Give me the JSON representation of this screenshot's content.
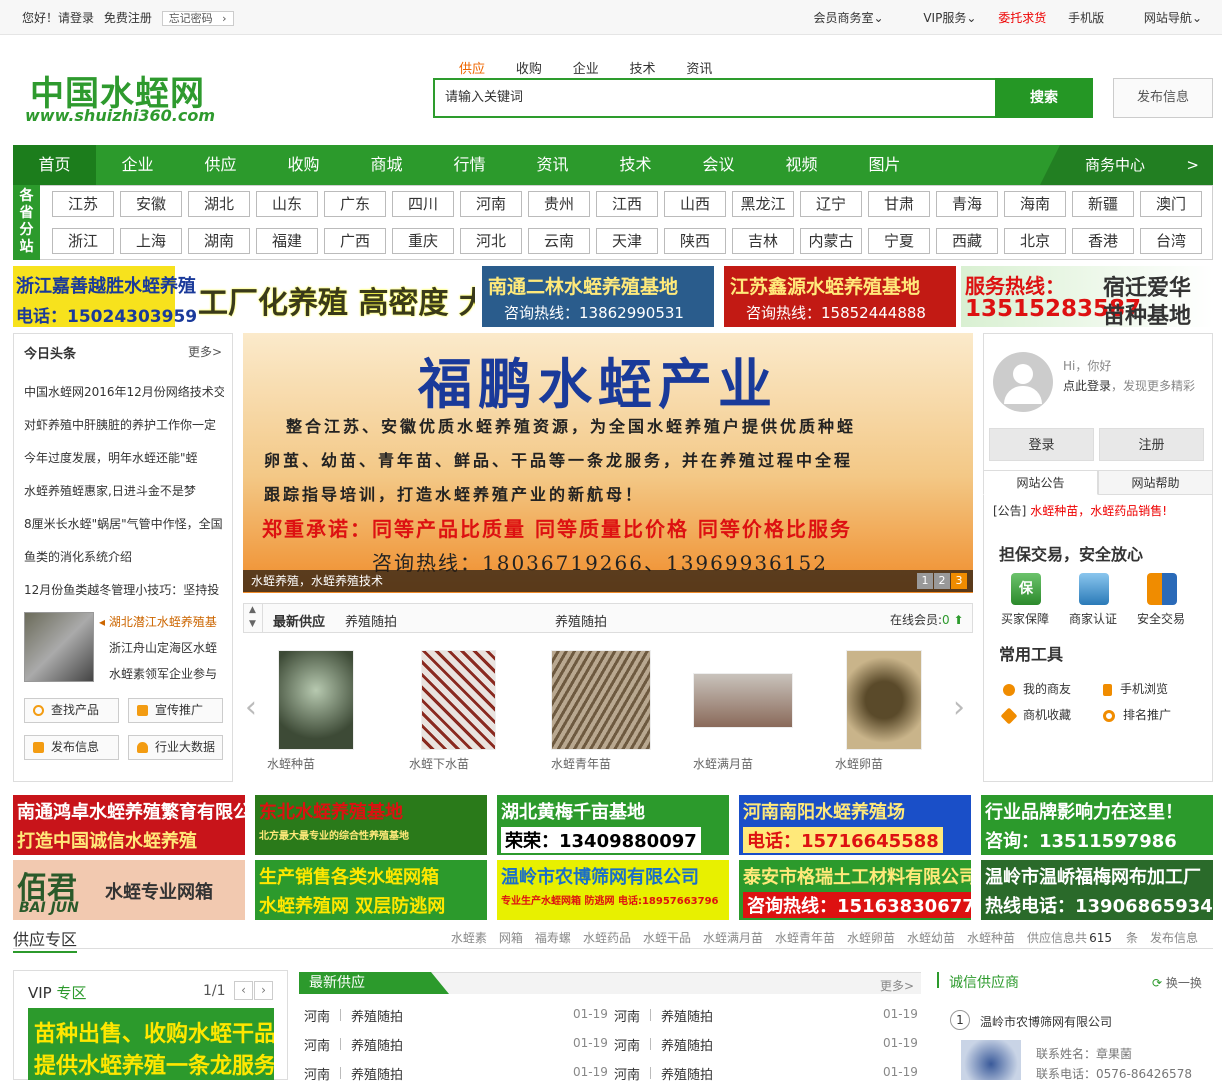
{
  "topbar": {
    "greeting": "您好！请登录",
    "register": "免费注册",
    "forgot": "忘记密码",
    "links": [
      "会员商务室",
      "VIP服务",
      "委托求货",
      "手机版",
      "网站导航"
    ]
  },
  "header": {
    "logo_cn": "中国水蛭网",
    "logo_url": "www.shuizhi360.com",
    "search_tabs": [
      "供应",
      "收购",
      "企业",
      "技术",
      "资讯"
    ],
    "search_placeholder": "请输入关键词",
    "search_button": "搜索",
    "publish_button": "发布信息"
  },
  "nav": {
    "items": [
      "首页",
      "企业",
      "供应",
      "收购",
      "商城",
      "行情",
      "资讯",
      "技术",
      "会议",
      "视频",
      "图片"
    ],
    "business_center": "商务中心",
    "arrow": ">"
  },
  "stations": {
    "label": "各省分站",
    "row1": [
      "江苏",
      "安徽",
      "湖北",
      "山东",
      "广东",
      "四川",
      "河南",
      "贵州",
      "江西",
      "山西",
      "黑龙江",
      "辽宁",
      "甘肃",
      "青海",
      "海南",
      "新疆",
      "澳门"
    ],
    "row2": [
      "浙江",
      "上海",
      "湖南",
      "福建",
      "广西",
      "重庆",
      "河北",
      "云南",
      "天津",
      "陕西",
      "吉林",
      "内蒙古",
      "宁夏",
      "西藏",
      "北京",
      "香港",
      "台湾"
    ]
  },
  "ads_top": {
    "a1_line1": "浙江嘉善越胜水蛭养殖",
    "a1_line2": "电话：15024303959",
    "a1_big": "工厂化养殖 高密度 大克重",
    "a2_line1": "南通二林水蛭养殖基地",
    "a2_line2": "咨询热线：13862990531",
    "a3_line1": "江苏鑫源水蛭养殖基地",
    "a3_line2": "咨询热线：15852444888",
    "a4_line1": "服务热线：",
    "a4_line2": "13515283587",
    "a4_right1": "宿迁爱华",
    "a4_right2": "苗种基地"
  },
  "left": {
    "title": "今日头条",
    "more": "更多>",
    "news": [
      "中国水蛭网2016年12月份网络技术交",
      "对虾养殖中肝胰脏的养护工作你一定",
      "今年过度发展，明年水蛭还能\"蛭",
      "水蛭养殖蛭惠家,日进斗金不是梦",
      "8厘米长水蛭\"蜗居\"气管中作怪，全国",
      "鱼类的消化系统介绍",
      "12月份鱼类越冬管理小技巧：坚持投"
    ],
    "featured": "湖北潜江水蛭养殖基",
    "sub_news": [
      "浙江舟山定海区水蛭",
      "水蛭素领军企业参与"
    ],
    "buttons": [
      "查找产品",
      "宣传推广",
      "发布信息",
      "行业大数据"
    ]
  },
  "slide": {
    "title": "福鹏水蛭产业",
    "lines": [
      "整合江苏、安徽优质水蛭养殖资源，为全国水蛭养殖户提供优质种蛭",
      "卵茧、幼苗、青年苗、鲜品、干品等一条龙服务，并在养殖过程中全程",
      "跟踪指导培训，打造水蛭养殖产业的新航母！"
    ],
    "promise": "郑重承诺：同等产品比质量 同等质量比价格 同等价格比服务",
    "hotline": "咨询热线：18036719266、13969936152",
    "caption": "水蛭养殖，水蛭养殖技术",
    "dots": [
      "1",
      "2",
      "3"
    ]
  },
  "supply": {
    "tabs": [
      "最新供应",
      "养殖随拍",
      "养殖随拍"
    ],
    "online_label": "在线会员:",
    "online_count": "0",
    "products": [
      "水蛭种苗",
      "水蛭下水苗",
      "水蛭青年苗",
      "水蛭满月苗",
      "水蛭卵苗"
    ]
  },
  "right": {
    "hi": "Hi，你好",
    "login_prompt": "点此登录",
    "discover": "，发现更多精彩",
    "login": "登录",
    "register": "注册",
    "tabs": [
      "网站公告",
      "网站帮助"
    ],
    "notice_prefix": "[公告]",
    "notice": "水蛭种苗，水蛭药品销售!",
    "guarantee_title": "担保交易，安全放心",
    "badges": [
      "买家保障",
      "商家认证",
      "安全交易"
    ],
    "badge_char": "保",
    "tools_title": "常用工具",
    "tools": [
      "我的商友",
      "手机浏览",
      "商机收藏",
      "排名推广"
    ]
  },
  "ads_mid": {
    "r1": [
      {
        "l1": "南通鸿卓水蛭养殖繁育有限公司",
        "l2": "打造中国诚信水蛭养殖"
      },
      {
        "l1": "东北水蛭养殖基地",
        "l2": "北方最大最专业的综合性养殖基地"
      },
      {
        "l1": "湖北黄梅千亩基地",
        "l2": "荣荣：13409880097"
      },
      {
        "l1": "河南南阳水蛭养殖场",
        "l2": "电话：15716645588"
      },
      {
        "l1": "行业品牌影响力在这里！",
        "l2": "咨询：13511597986"
      }
    ],
    "r2": [
      {
        "l1": "佰君",
        "l2": "水蛭专业网箱",
        "l3": "BAI JUN"
      },
      {
        "l1": "生产销售各类水蛭网箱",
        "l2": "水蛭养殖网 双层防逃网"
      },
      {
        "l1": "温岭市农博筛网有限公司",
        "l2": "专业生产水蛭网箱 防逃网 电话:18957663796"
      },
      {
        "l1": "泰安市格瑞土工材料有限公司",
        "l2": "咨询热线：15163830677"
      },
      {
        "l1": "温岭市温峤福梅网布加工厂",
        "l2": "热线电话：13906865934"
      }
    ]
  },
  "section": {
    "title": "供应专区",
    "links": [
      "水蛭素",
      "网箱",
      "福寿螺",
      "水蛭药品",
      "水蛭干品",
      "水蛭满月苗",
      "水蛭青年苗",
      "水蛭卵苗",
      "水蛭幼苗",
      "水蛭种苗"
    ],
    "count_prefix": "供应信息共",
    "count": "615",
    "count_suffix": "条",
    "publish": "发布信息"
  },
  "vip": {
    "title_a": "VIP",
    "title_b": "专区",
    "page": "1/1",
    "ad_line1": "苗种出售、收购水蛭干品",
    "ad_line2": "提供水蛭养殖一条龙服务"
  },
  "latest": {
    "title": "最新供应",
    "more": "更多>",
    "rows": [
      {
        "region": "河南",
        "title": "养殖随拍",
        "date": "01-19",
        "region2": "河南",
        "title2": "养殖随拍",
        "date2": "01-19"
      },
      {
        "region": "河南",
        "title": "养殖随拍",
        "date": "01-19",
        "region2": "河南",
        "title2": "养殖随拍",
        "date2": "01-19"
      },
      {
        "region": "河南",
        "title": "养殖随拍",
        "date": "01-19",
        "region2": "河南",
        "title2": "养殖随拍",
        "date2": "01-19"
      }
    ]
  },
  "credit": {
    "title": "诚信供应商",
    "refresh": "换一换",
    "rank": "1",
    "company": "温岭市农博筛网有限公司",
    "contact_label": "联系姓名：",
    "contact_name": "章果菌",
    "phone_label": "联系电话：",
    "phone": "0576-86426578"
  }
}
